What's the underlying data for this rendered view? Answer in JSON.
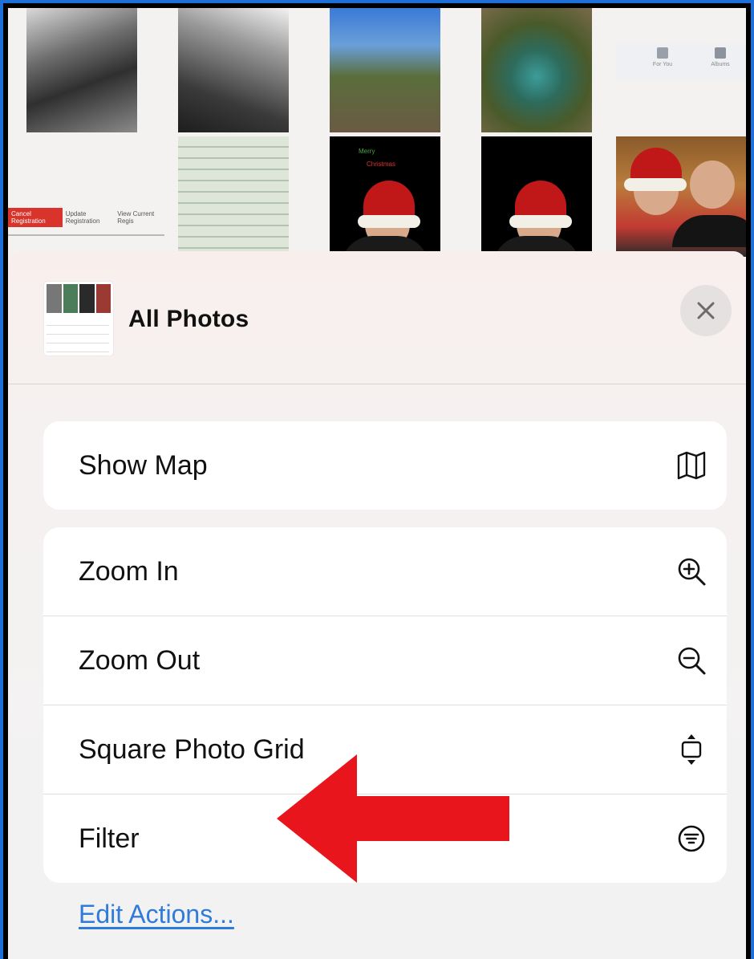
{
  "background": {
    "registration_buttons": [
      "Cancel Registration",
      "Update Registration",
      "View Current Regis"
    ],
    "toolbar_items": [
      "For You",
      "Albums"
    ],
    "card_text": [
      "Merry",
      "Christmas"
    ]
  },
  "sheet": {
    "title": "All Photos",
    "close_icon": "close-icon"
  },
  "menu": {
    "group1": [
      {
        "label": "Show Map",
        "icon": "map-icon"
      }
    ],
    "group2": [
      {
        "label": "Zoom In",
        "icon": "zoom-in-icon"
      },
      {
        "label": "Zoom Out",
        "icon": "zoom-out-icon"
      },
      {
        "label": "Square Photo Grid",
        "icon": "aspect-toggle-icon"
      },
      {
        "label": "Filter",
        "icon": "filter-icon"
      }
    ]
  },
  "footer": {
    "edit_actions": "Edit Actions..."
  },
  "colors": {
    "frame": "#1f6fd8",
    "link": "#2f7bd9",
    "arrow": "#e8161c"
  }
}
